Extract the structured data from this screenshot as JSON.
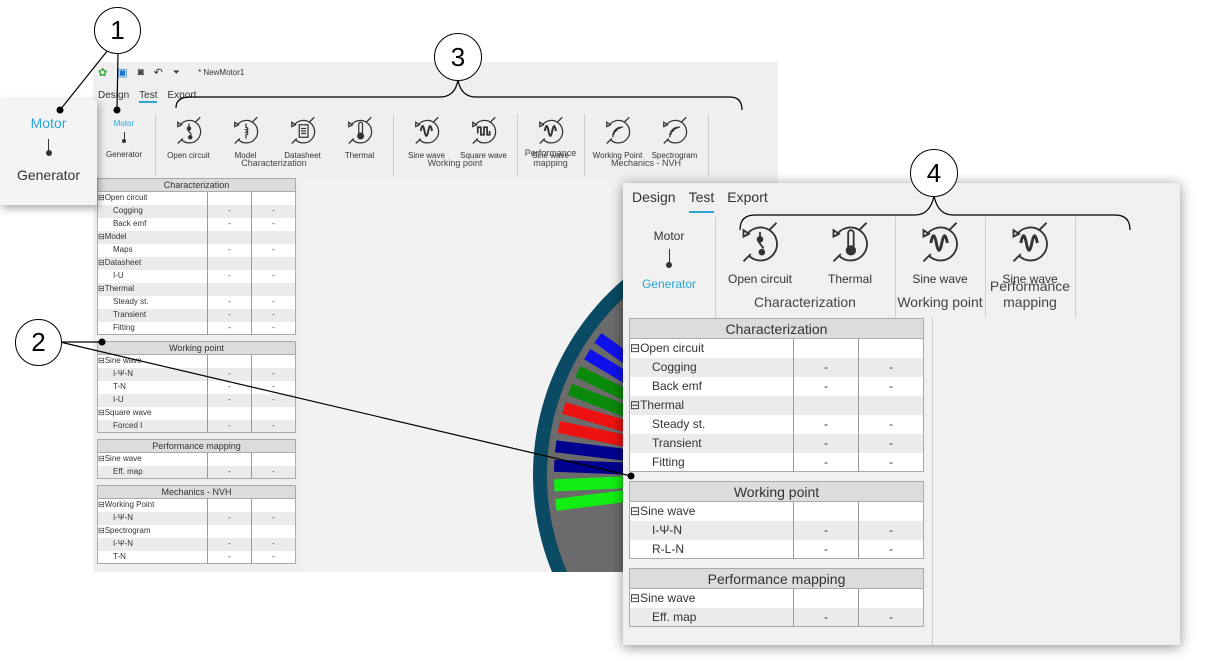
{
  "callouts": [
    "1",
    "2",
    "3",
    "4"
  ],
  "window": {
    "title": "* NewMotor1",
    "toolbar_icons": [
      "app-logo-icon",
      "save-icon",
      "camera-icon",
      "undo-icon",
      "dropdown-icon"
    ],
    "tabs": [
      "Design",
      "Test",
      "Export"
    ],
    "active_tab": "Test",
    "mode": {
      "motor": "Motor",
      "generator": "Generator",
      "selected": "Motor"
    },
    "ribbon": {
      "groups": [
        {
          "label": "Characterization",
          "buttons": [
            "Open circuit",
            "Model",
            "Datasheet",
            "Thermal"
          ]
        },
        {
          "label": "Working point",
          "buttons": [
            "Sine wave",
            "Square wave"
          ]
        },
        {
          "label": "Performance mapping",
          "buttons": [
            "Sine wave"
          ]
        },
        {
          "label": "Mechanics - NVH",
          "buttons": [
            "Working Point",
            "Spectrogram"
          ]
        }
      ]
    },
    "tables": [
      {
        "title": "Characterization",
        "rows": [
          {
            "group": "Open circuit"
          },
          {
            "name": "Cogging",
            "v1": "-",
            "v2": "-"
          },
          {
            "name": "Back emf",
            "v1": "-",
            "v2": "-"
          },
          {
            "group": "Model"
          },
          {
            "name": "Maps",
            "v1": "-",
            "v2": "-"
          },
          {
            "group": "Datasheet"
          },
          {
            "name": "I-U",
            "v1": "-",
            "v2": "-"
          },
          {
            "group": "Thermal"
          },
          {
            "name": "Steady st.",
            "v1": "-",
            "v2": "-"
          },
          {
            "name": "Transient",
            "v1": "-",
            "v2": "-"
          },
          {
            "name": "Fitting",
            "v1": "-",
            "v2": "-"
          }
        ]
      },
      {
        "title": "Working point",
        "rows": [
          {
            "group": "Sine wave"
          },
          {
            "name": "I-Ψ-N",
            "v1": "-",
            "v2": "-"
          },
          {
            "name": "T-N",
            "v1": "-",
            "v2": "-"
          },
          {
            "name": "I-U",
            "v1": "-",
            "v2": "-"
          },
          {
            "group": "Square wave"
          },
          {
            "name": "Forced I",
            "v1": "-",
            "v2": "-"
          }
        ]
      },
      {
        "title": "Performance mapping",
        "rows": [
          {
            "group": "Sine wave"
          },
          {
            "name": "Eff. map",
            "v1": "-",
            "v2": "-"
          }
        ]
      },
      {
        "title": "Mechanics - NVH",
        "rows": [
          {
            "group": "Working Point"
          },
          {
            "name": "I-Ψ-N",
            "v1": "-",
            "v2": "-"
          },
          {
            "group": "Spectrogram"
          },
          {
            "name": "I-Ψ-N",
            "v1": "-",
            "v2": "-"
          },
          {
            "name": "T-N",
            "v1": "-",
            "v2": "-"
          }
        ]
      }
    ]
  },
  "popup": {
    "motor": "Motor",
    "generator": "Generator",
    "selected": "Motor"
  },
  "panel": {
    "tabs": [
      "Design",
      "Test",
      "Export"
    ],
    "active_tab": "Test",
    "mode": {
      "motor": "Motor",
      "generator": "Generator",
      "selected": "Generator"
    },
    "ribbon": {
      "groups": [
        {
          "label": "Characterization",
          "buttons": [
            "Open circuit",
            "Thermal"
          ]
        },
        {
          "label": "Working point",
          "buttons": [
            "Sine wave"
          ]
        },
        {
          "label": "Performance mapping",
          "buttons": [
            "Sine wave"
          ]
        }
      ]
    },
    "tables": [
      {
        "title": "Characterization",
        "rows": [
          {
            "group": "Open circuit"
          },
          {
            "name": "Cogging",
            "v1": "-",
            "v2": "-"
          },
          {
            "name": "Back emf",
            "v1": "-",
            "v2": "-"
          },
          {
            "group": "Thermal"
          },
          {
            "name": "Steady st.",
            "v1": "-",
            "v2": "-"
          },
          {
            "name": "Transient",
            "v1": "-",
            "v2": "-"
          },
          {
            "name": "Fitting",
            "v1": "-",
            "v2": "-"
          }
        ]
      },
      {
        "title": "Working point",
        "rows": [
          {
            "group": "Sine wave"
          },
          {
            "name": "I-Ψ-N",
            "v1": "-",
            "v2": "-"
          },
          {
            "name": "R-L-N",
            "v1": "-",
            "v2": "-"
          }
        ]
      },
      {
        "title": "Performance mapping",
        "rows": [
          {
            "group": "Sine wave"
          },
          {
            "name": "Eff. map",
            "v1": "-",
            "v2": "-"
          }
        ]
      }
    ]
  },
  "colors": {
    "accent": "#2aa6d6",
    "stator_ring": "#0b4a63",
    "rotor": "#6b6b6b"
  }
}
